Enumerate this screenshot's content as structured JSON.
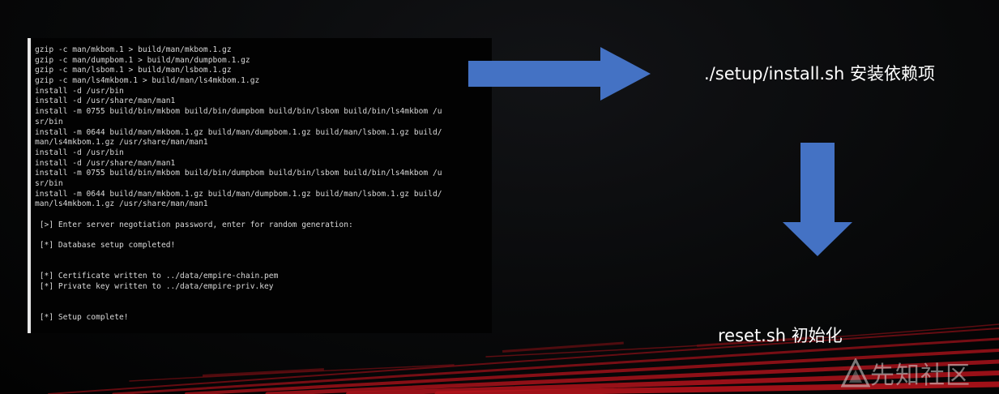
{
  "terminal": {
    "lines": [
      "gzip -c man/mkbom.1 > build/man/mkbom.1.gz",
      "gzip -c man/dumpbom.1 > build/man/dumpbom.1.gz",
      "gzip -c man/lsbom.1 > build/man/lsbom.1.gz",
      "gzip -c man/ls4mkbom.1 > build/man/ls4mkbom.1.gz",
      "install -d /usr/bin",
      "install -d /usr/share/man/man1",
      "install -m 0755 build/bin/mkbom build/bin/dumpbom build/bin/lsbom build/bin/ls4mkbom /u",
      "sr/bin",
      "install -m 0644 build/man/mkbom.1.gz build/man/dumpbom.1.gz build/man/lsbom.1.gz build/",
      "man/ls4mkbom.1.gz /usr/share/man/man1",
      "install -d /usr/bin",
      "install -d /usr/share/man/man1",
      "install -m 0755 build/bin/mkbom build/bin/dumpbom build/bin/lsbom build/bin/ls4mkbom /u",
      "sr/bin",
      "install -m 0644 build/man/mkbom.1.gz build/man/dumpbom.1.gz build/man/lsbom.1.gz build/",
      "man/ls4mkbom.1.gz /usr/share/man/man1",
      "",
      " [>] Enter server negotiation password, enter for random generation:",
      "",
      " [*] Database setup completed!",
      "",
      "",
      " [*] Certificate written to ../data/empire-chain.pem",
      " [*] Private key written to ../data/empire-priv.key",
      "",
      "",
      " [*] Setup complete!"
    ]
  },
  "captions": {
    "install": "./setup/install.sh 安装依赖项",
    "reset": "reset.sh 初始化"
  },
  "watermark": {
    "text": "先知社区"
  },
  "colors": {
    "arrow": "#4472c4",
    "terminal_bg": "#020202",
    "terminal_text": "#d9d9d9",
    "caption_text": "#ffffff",
    "accent_red": "#b3131b"
  },
  "icons": {
    "right_arrow": "right-arrow-icon",
    "down_arrow": "down-arrow-icon",
    "watermark_logo": "xianzhi-logo-icon"
  }
}
